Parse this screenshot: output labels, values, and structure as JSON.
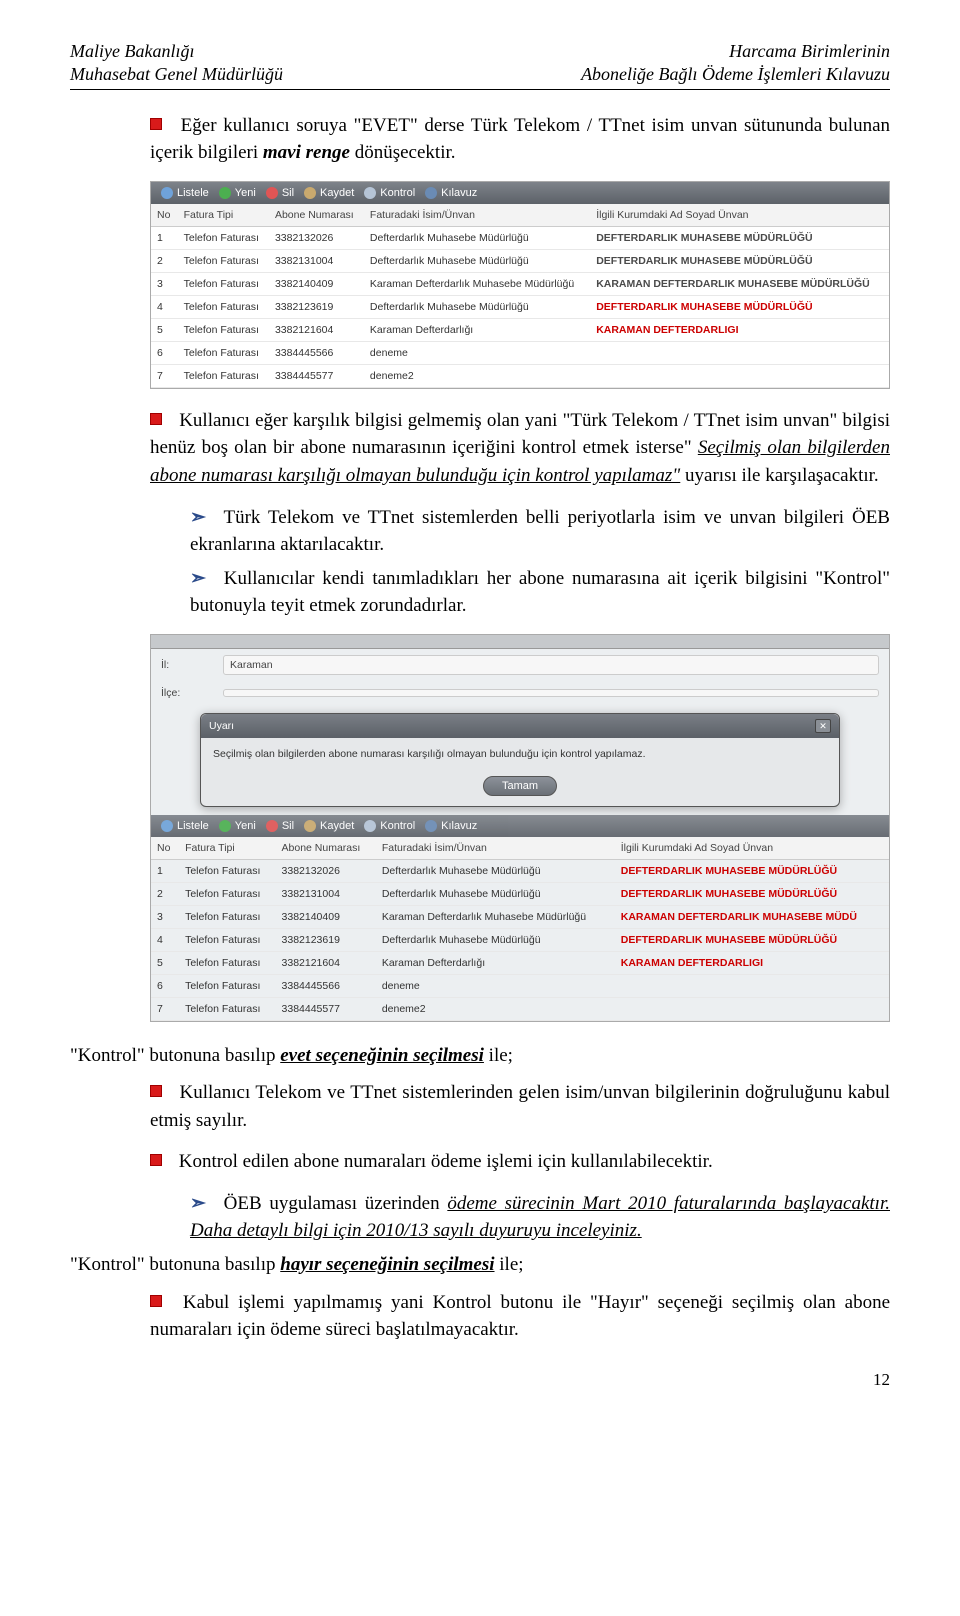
{
  "header": {
    "left_line1": "Maliye Bakanlığı",
    "left_line2": "Muhasebat Genel Müdürlüğü",
    "right_line1": "Harcama Birimlerinin",
    "right_line2": "Aboneliğe Bağlı Ödeme İşlemleri Kılavuzu"
  },
  "para1_pre": "Eğer kullanıcı soruya \"EVET\" derse Türk Telekom / TTnet isim unvan sütununda bulunan içerik bilgileri ",
  "para1_em": "mavi renge",
  "para1_post": " dönüşecektir.",
  "toolbar": {
    "listele": "Listele",
    "yeni": "Yeni",
    "sil": "Sil",
    "kaydet": "Kaydet",
    "kontrol": "Kontrol",
    "kilavuz": "Kılavuz"
  },
  "grid1": {
    "headers": {
      "no": "No",
      "fatura": "Fatura Tipi",
      "abone": "Abone Numarası",
      "isim": "Faturadaki İsim/Ünvan",
      "ilgili": "İlgili Kurumdaki Ad Soyad Ünvan"
    },
    "rows": [
      {
        "no": "1",
        "fatura": "Telefon Faturası",
        "abone": "3382132026",
        "isim": "Defterdarlık Muhasebe Müdürlüğü",
        "ilgili": "DEFTERDARLIK MUHASEBE MÜDÜRLÜĞÜ",
        "red": false
      },
      {
        "no": "2",
        "fatura": "Telefon Faturası",
        "abone": "3382131004",
        "isim": "Defterdarlık Muhasebe Müdürlüğü",
        "ilgili": "DEFTERDARLIK MUHASEBE MÜDÜRLÜĞÜ",
        "red": false
      },
      {
        "no": "3",
        "fatura": "Telefon Faturası",
        "abone": "3382140409",
        "isim": "Karaman Defterdarlık Muhasebe Müdürlüğü",
        "ilgili": "KARAMAN DEFTERDARLIK MUHASEBE MÜDÜRLÜĞÜ",
        "red": false
      },
      {
        "no": "4",
        "fatura": "Telefon Faturası",
        "abone": "3382123619",
        "isim": "Defterdarlık Muhasebe Müdürlüğü",
        "ilgili": "DEFTERDARLIK MUHASEBE MÜDÜRLÜĞÜ",
        "red": true
      },
      {
        "no": "5",
        "fatura": "Telefon Faturası",
        "abone": "3382121604",
        "isim": "Karaman Defterdarlığı",
        "ilgili": "KARAMAN DEFTERDARLIGI",
        "red": true
      },
      {
        "no": "6",
        "fatura": "Telefon Faturası",
        "abone": "3384445566",
        "isim": "deneme",
        "ilgili": "",
        "red": false
      },
      {
        "no": "7",
        "fatura": "Telefon Faturası",
        "abone": "3384445577",
        "isim": "deneme2",
        "ilgili": "",
        "red": false
      }
    ]
  },
  "para2_pre": "Kullanıcı eğer karşılık bilgisi gelmemiş olan yani \"Türk Telekom / TTnet isim unvan\" bilgisi henüz boş olan bir abone numarasının içeriğini kontrol etmek isterse\" ",
  "para2_em": "Seçilmiş olan bilgilerden abone numarası karşılığı olmayan bulunduğu için kontrol yapılamaz\"",
  "para2_post": " uyarısı ile karşılaşacaktır.",
  "sub1": "Türk Telekom ve TTnet sistemlerden belli periyotlarla isim ve unvan bilgileri ÖEB ekranlarına aktarılacaktır.",
  "sub2": "Kullanıcılar kendi tanımladıkları her abone numarasına ait içerik bilgisini \"Kontrol\" butonuyla teyit etmek zorundadırlar.",
  "shot2": {
    "il_label": "İl:",
    "il_value": "Karaman",
    "ilce_label": "İlçe:",
    "ilce_value": "",
    "dialog_title": "Uyarı",
    "dialog_body": "Seçilmiş olan bilgilerden abone numarası karşılığı olmayan bulunduğu için kontrol yapılamaz.",
    "dialog_btn": "Tamam"
  },
  "grid2": {
    "headers": {
      "no": "No",
      "fatura": "Fatura Tipi",
      "abone": "Abone Numarası",
      "isim": "Faturadaki İsim/Ünvan",
      "ilgili": "İlgili Kurumdaki Ad Soyad Ünvan"
    },
    "rows": [
      {
        "no": "1",
        "fatura": "Telefon Faturası",
        "abone": "3382132026",
        "isim": "Defterdarlık Muhasebe Müdürlüğü",
        "ilgili": "DEFTERDARLIK MUHASEBE MÜDÜRLÜĞÜ",
        "red": true
      },
      {
        "no": "2",
        "fatura": "Telefon Faturası",
        "abone": "3382131004",
        "isim": "Defterdarlık Muhasebe Müdürlüğü",
        "ilgili": "DEFTERDARLIK MUHASEBE MÜDÜRLÜĞÜ",
        "red": true
      },
      {
        "no": "3",
        "fatura": "Telefon Faturası",
        "abone": "3382140409",
        "isim": "Karaman Defterdarlık Muhasebe Müdürlüğü",
        "ilgili": "KARAMAN DEFTERDARLIK MUHASEBE MÜDÜ",
        "red": true
      },
      {
        "no": "4",
        "fatura": "Telefon Faturası",
        "abone": "3382123619",
        "isim": "Defterdarlık Muhasebe Müdürlüğü",
        "ilgili": "DEFTERDARLIK MUHASEBE MÜDÜRLÜĞÜ",
        "red": true
      },
      {
        "no": "5",
        "fatura": "Telefon Faturası",
        "abone": "3382121604",
        "isim": "Karaman Defterdarlığı",
        "ilgili": "KARAMAN DEFTERDARLIGI",
        "red": true
      },
      {
        "no": "6",
        "fatura": "Telefon Faturası",
        "abone": "3384445566",
        "isim": "deneme",
        "ilgili": "",
        "red": false
      },
      {
        "no": "7",
        "fatura": "Telefon Faturası",
        "abone": "3384445577",
        "isim": "deneme2",
        "ilgili": "",
        "red": false
      }
    ]
  },
  "line_evet_pre": "\"Kontrol\" butonuna basılıp ",
  "line_evet_em": "evet seçeneğinin seçilmesi",
  "line_evet_post": " ile;",
  "evet_b1": "Kullanıcı Telekom ve TTnet sistemlerinden gelen isim/unvan bilgilerinin doğruluğunu kabul etmiş sayılır.",
  "evet_b2": "Kontrol edilen abone numaraları ödeme işlemi için kullanılabilecektir.",
  "evet_sub_pre": "ÖEB uygulaması üzerinden ",
  "evet_sub_em": "ödeme sürecinin Mart 2010 faturalarında başlayacaktır. Daha detaylı bilgi için 2010/13 sayılı duyuruyu inceleyiniz.",
  "line_hayir_pre": "\"Kontrol\" butonuna basılıp ",
  "line_hayir_em": "hayır seçeneğinin seçilmesi",
  "line_hayir_post": " ile;",
  "hayir_b1": "Kabul işlemi yapılmamış yani Kontrol butonu ile \"Hayır\" seçeneği seçilmiş olan abone numaraları için ödeme süreci başlatılmayacaktır.",
  "page": "12"
}
